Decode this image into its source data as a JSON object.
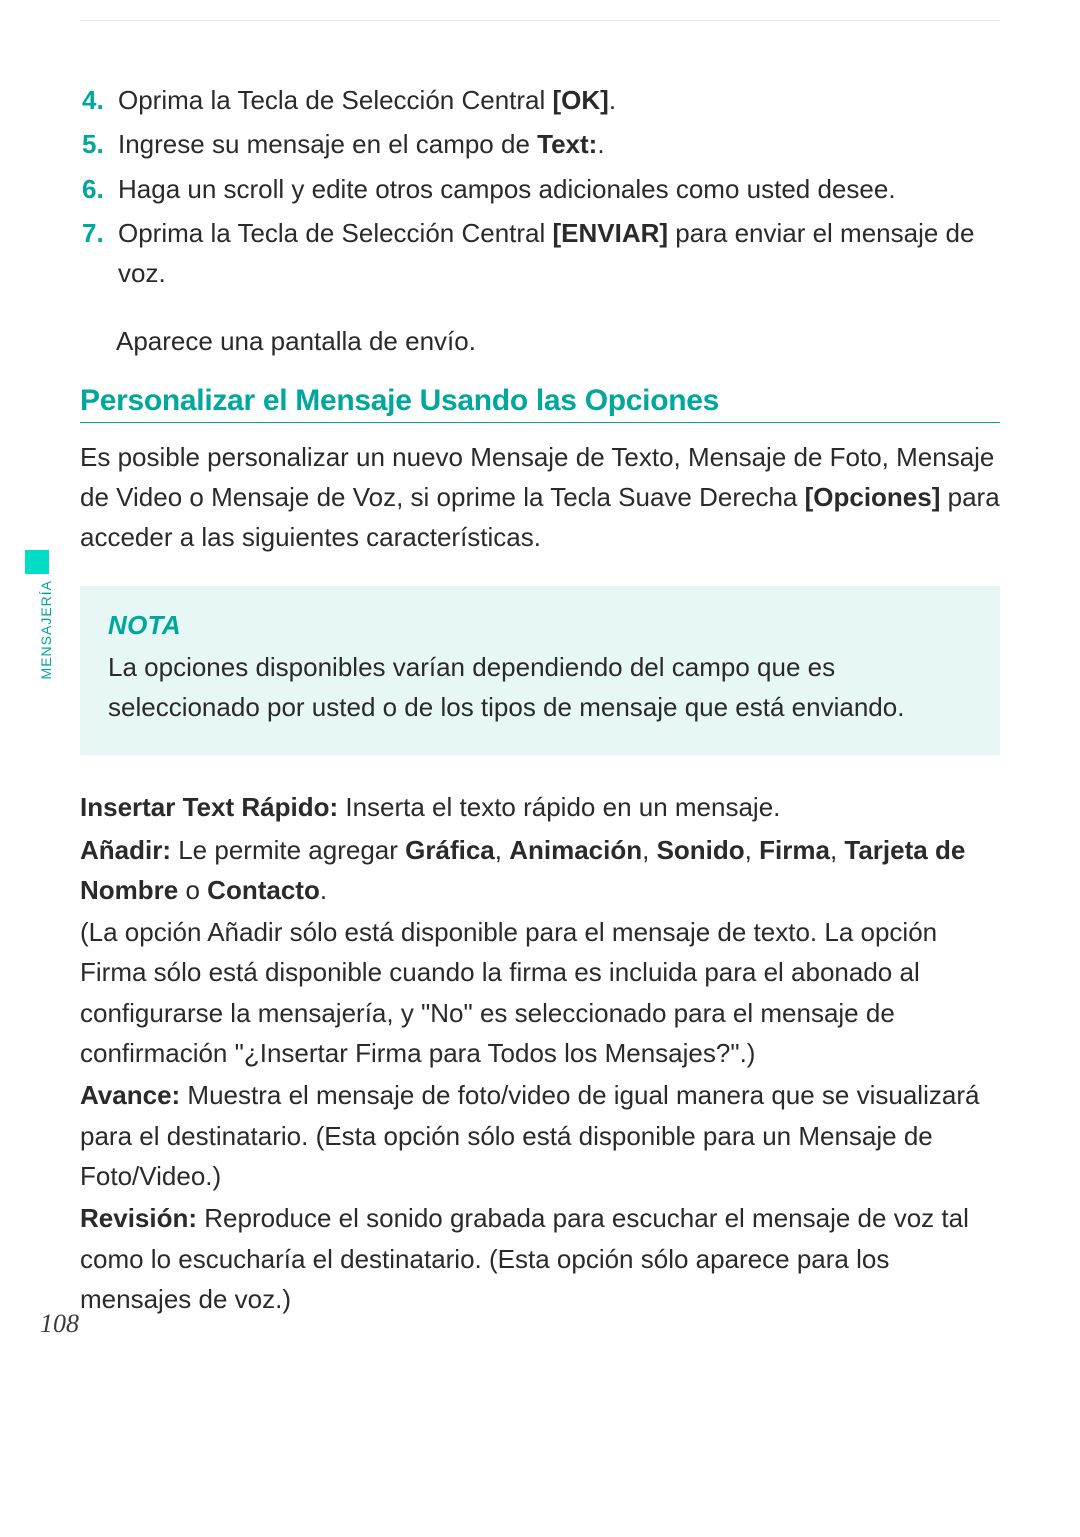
{
  "side": {
    "section": "MENSAJERÍA"
  },
  "pageNumber": "108",
  "steps": {
    "s4": {
      "num": "4.",
      "pre": " Oprima la Tecla de Selección Central ",
      "bold": "[OK]",
      "post": "."
    },
    "s5": {
      "num": "5.",
      "pre": " Ingrese su mensaje en el campo de ",
      "bold": "Text:",
      "post": "."
    },
    "s6": {
      "num": "6.",
      "text": " Haga un scroll y edite otros campos adicionales como usted desee."
    },
    "s7": {
      "num": "7.",
      "pre": " Oprima la Tecla de Selección Central ",
      "bold": "[ENVIAR]",
      "post": " para enviar el mensaje de voz."
    },
    "sub7": "Aparece una pantalla de envío."
  },
  "heading": "Personalizar el Mensaje Usando las Opciones",
  "intro": {
    "pre": "Es posible personalizar un nuevo Mensaje de Texto, Mensaje de Foto, Mensaje de Video o Mensaje de Voz, si oprime la Tecla Suave Derecha ",
    "bold": "[Opciones]",
    "post": " para acceder a las siguientes características."
  },
  "note": {
    "label": "NOTA",
    "body": "La opciones disponibles varían dependiendo del campo que es seleccionado por usted o de los tipos de mensaje que está enviando."
  },
  "opts": {
    "instr": {
      "label": "Insertar Text Rápido:",
      "text": " Inserta el texto rápido en un mensaje."
    },
    "an": {
      "label": "Añadir:",
      "pre": " Le permite agregar ",
      "b1": "Gráfica",
      "sep1": ", ",
      "b2": "Animación",
      "sep2": ", ",
      "b3": "Sonido",
      "sep3": ", ",
      "b4": "Firma",
      "sep4": ", ",
      "b5": "Tarjeta de Nombre",
      "sep5": " o ",
      "b6": "Contacto",
      "end": "."
    },
    "anNote": "(La opción Añadir sólo está disponible para el mensaje de texto. La opción Firma sólo está disponible cuando la firma es incluida para el abonado al configurarse la mensajería, y \"No\" es seleccionado para el mensaje de confirmación \"¿Insertar Firma para Todos los Mensajes?\".)",
    "av": {
      "label": "Avance:",
      "text": " Muestra el mensaje de foto/video de igual manera que se visualizará para el destinatario. (Esta opción sólo está disponible para un Mensaje de Foto/Video.)"
    },
    "rev": {
      "label": "Revisión:",
      "text": " Reproduce el sonido grabada para escuchar el mensaje de voz tal como lo escucharía el destinatario. (Esta opción sólo aparece para los mensajes de voz.)"
    }
  }
}
